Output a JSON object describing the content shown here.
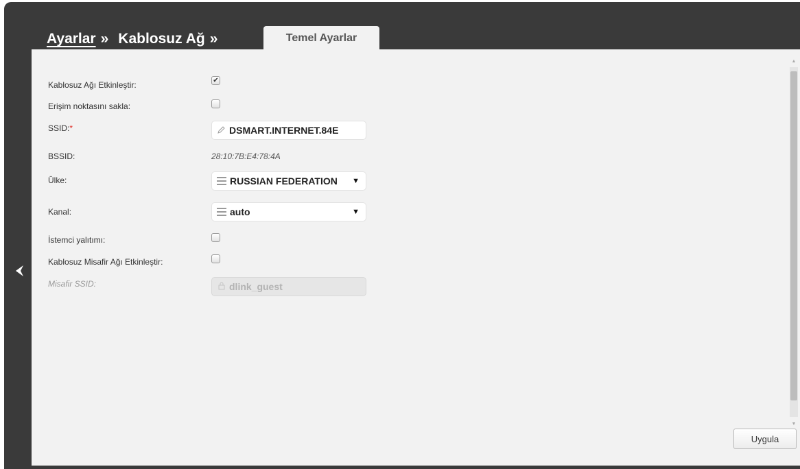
{
  "breadcrumb": {
    "root": "Ayarlar",
    "separator": "»",
    "section": "Kablosuz Ağ",
    "separator2": "»"
  },
  "tab": {
    "label": "Temel Ayarlar"
  },
  "form": {
    "enable_wifi": {
      "label": "Kablosuz Ağı Etkinleştir:",
      "checked": true,
      "check_glyph": "✔"
    },
    "hide_ap": {
      "label": "Erişim noktasını sakla:",
      "checked": false
    },
    "ssid": {
      "label": "SSID:",
      "required_mark": "*",
      "value": "DSMART.INTERNET.84E",
      "icon": "pencil-icon"
    },
    "bssid": {
      "label": "BSSID:",
      "value": "28:10:7B:E4:78:4A"
    },
    "country": {
      "label": "Ülke:",
      "value": "RUSSIAN FEDERATION",
      "icon": "list-icon"
    },
    "channel": {
      "label": "Kanal:",
      "value": "auto",
      "icon": "list-icon"
    },
    "client_isolation": {
      "label": "İstemci yalıtımı:",
      "checked": false
    },
    "guest_enable": {
      "label": "Kablosuz Misafir Ağı Etkinleştir:",
      "checked": false
    },
    "guest_ssid": {
      "label": "Misafir SSID:",
      "value": "dlink_guest",
      "disabled": true
    }
  },
  "buttons": {
    "apply": "Uygula"
  },
  "colors": {
    "frame": "#3a3a3a",
    "panel": "#f2f2f2",
    "required": "#e0332b"
  }
}
